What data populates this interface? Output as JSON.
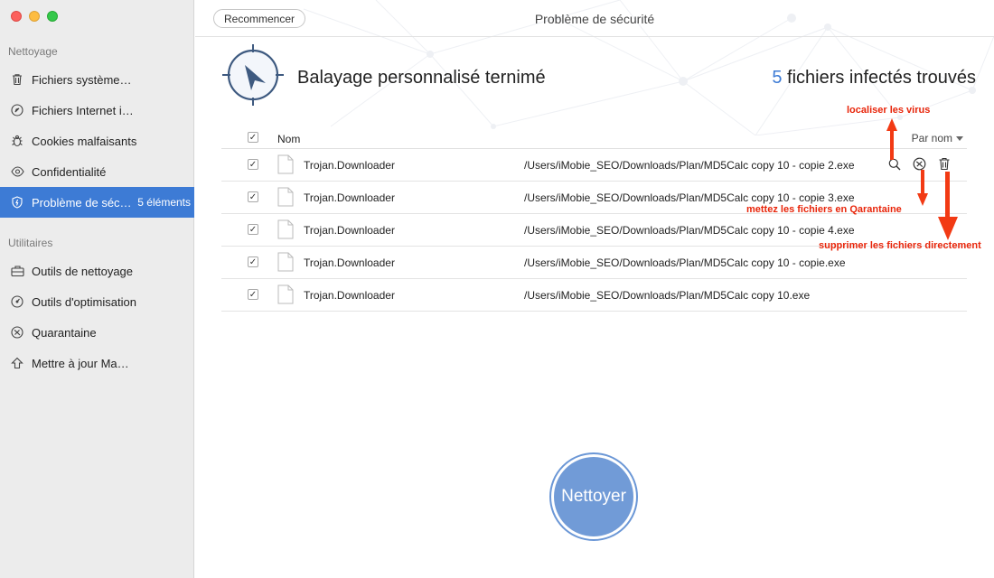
{
  "sidebar": {
    "section_cleaning": "Nettoyage",
    "section_utilities": "Utilitaires",
    "items": [
      {
        "label": "Fichiers système…",
        "icon": "trash-icon"
      },
      {
        "label": "Fichiers Internet i…",
        "icon": "compass-icon"
      },
      {
        "label": "Cookies malfaisants",
        "icon": "bug-icon"
      },
      {
        "label": "Confidentialité",
        "icon": "eye-icon"
      },
      {
        "label": "Problème de séc…",
        "icon": "shield-icon",
        "count": "5 éléments",
        "active": true
      }
    ],
    "utilities": [
      {
        "label": "Outils de nettoyage",
        "icon": "toolbox-icon"
      },
      {
        "label": "Outils d'optimisation",
        "icon": "gauge-icon"
      },
      {
        "label": "Quarantaine",
        "icon": "quarantine-icon"
      },
      {
        "label": "Mettre à jour Ma…",
        "icon": "update-icon"
      }
    ]
  },
  "header": {
    "restart_label": "Recommencer",
    "title": "Problème de sécurité"
  },
  "summary": {
    "scan_title": "Balayage personnalisé ternimé",
    "count": "5",
    "found_text": " fichiers infectés trouvés"
  },
  "table": {
    "col_name": "Nom",
    "sort_label": "Par nom",
    "rows": [
      {
        "name": "Trojan.Downloader",
        "path": "/Users/iMobie_SEO/Downloads/Plan/MD5Calc copy 10 - copie 2.exe",
        "checked": true
      },
      {
        "name": "Trojan.Downloader",
        "path": "/Users/iMobie_SEO/Downloads/Plan/MD5Calc copy 10 - copie 3.exe",
        "checked": true
      },
      {
        "name": "Trojan.Downloader",
        "path": "/Users/iMobie_SEO/Downloads/Plan/MD5Calc copy 10 - copie 4.exe",
        "checked": true
      },
      {
        "name": "Trojan.Downloader",
        "path": "/Users/iMobie_SEO/Downloads/Plan/MD5Calc copy 10 - copie.exe",
        "checked": true
      },
      {
        "name": "Trojan.Downloader",
        "path": "/Users/iMobie_SEO/Downloads/Plan/MD5Calc copy 10.exe",
        "checked": true
      }
    ]
  },
  "annotations": {
    "locate": "localiser les virus",
    "quarantine": "mettez les fichiers en Qarantaine",
    "delete": "supprimer les fichiers directement"
  },
  "clean_label": "Nettoyer",
  "colors": {
    "accent": "#3d7bd5",
    "annotation": "#e8250a",
    "button": "#719bd7"
  }
}
